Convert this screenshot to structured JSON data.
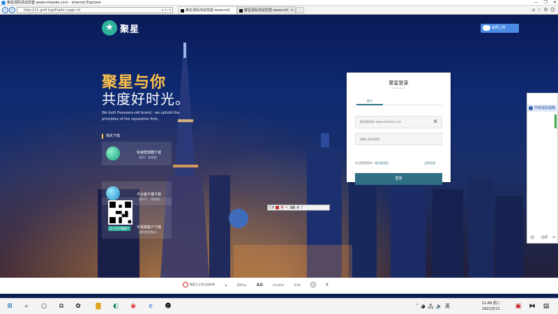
{
  "window": {
    "title": "聚星源码测试前登-www.mitaoke.com - Internet Explorer",
    "controls": [
      "—",
      "❐",
      "✕"
    ]
  },
  "address": {
    "url": "http://11 goH top/Public Login ht",
    "controls": "▾ ↻ ✕"
  },
  "tabs": [
    {
      "label": "聚星源码测试前登-www.mit"
    },
    {
      "label": "聚星源码测试前登-www.mit"
    }
  ],
  "toolbar_icons": [
    "⌂",
    "☆",
    "⚙",
    "☺"
  ],
  "upload_button": "拍照上传",
  "brand": {
    "name": "聚星"
  },
  "hero": {
    "headline1": "聚星与你",
    "headline2": "共度好时光。",
    "tagline": "We built fiveyears-old brand，we uphold the principles of the reputation first。"
  },
  "downloads": {
    "title": "相关下载",
    "cards": [
      {
        "name": "快速登录器下载",
        "desc": "（直冲、游戏登）"
      },
      {
        "name": "平台客户端下载",
        "desc": "（直冲下、游戏版）"
      },
      {
        "name": "手机端客户下载",
        "desc": "（随时随地畅玩）",
        "badge": "扫一扫下载客户"
      }
    ]
  },
  "ime_bar": {
    "label": "CH",
    "mode": "英"
  },
  "login": {
    "title": "聚星登录",
    "subtitle": "Juxing Login",
    "tab_account": "帐号",
    "username_value": "聚星源码网--www.mitaoke.com",
    "password_placeholder": "请输入账号密码",
    "forgot_text": "忘记登录密码？",
    "contact_text": "请点此找回",
    "register": "立即注册",
    "submit": "登录"
  },
  "side_chat": {
    "header": "开启消息提醒",
    "info_icon": "i",
    "icons": [
      "☹",
      "GIF",
      "✂"
    ]
  },
  "footer": {
    "partners": [
      "聚星卫士防沉迷系统",
      "★",
      "ZDPlus",
      "AG",
      "fovation",
      "ICRA",
      "18",
      "备"
    ]
  },
  "taskbar": {
    "time": "11:49 周二",
    "date": "2021/5/11",
    "tray_lang": "英"
  }
}
